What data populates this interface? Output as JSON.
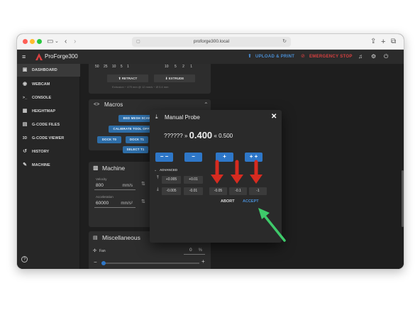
{
  "browser": {
    "url": "proforge300.local",
    "icons": [
      "sidebar-toggle-icon",
      "back-icon",
      "forward-icon",
      "lock-icon",
      "reload-icon",
      "share-icon",
      "new-tab-icon",
      "tabs-icon"
    ]
  },
  "appbar": {
    "title": "ProForge300",
    "upload_label": "UPLOAD & PRINT",
    "emergency_label": "EMERGENCY STOP",
    "colors": {
      "upload": "#4a8fd6",
      "emergency": "#d94040",
      "logo": "#d94040"
    }
  },
  "sidebar": {
    "items": [
      {
        "label": "DASHBOARD",
        "icon": "dashboard-icon",
        "glyph": "▣",
        "active": true
      },
      {
        "label": "WEBCAM",
        "icon": "webcam-icon",
        "glyph": "◉"
      },
      {
        "label": "CONSOLE",
        "icon": "console-icon",
        "glyph": ">_"
      },
      {
        "label": "HEIGHTMAP",
        "icon": "heightmap-icon",
        "glyph": "▦"
      },
      {
        "label": "G-CODE FILES",
        "icon": "files-icon",
        "glyph": "▤"
      },
      {
        "label": "G-CODE VIEWER",
        "icon": "viewer-3d-icon",
        "glyph": "3D"
      },
      {
        "label": "HISTORY",
        "icon": "history-icon",
        "glyph": "↺"
      },
      {
        "label": "MACHINE",
        "icon": "wrench-icon",
        "glyph": "✎"
      }
    ],
    "help_glyph": "?"
  },
  "extruder": {
    "amount_row_left": [
      "50",
      "25",
      "10",
      "5",
      "1"
    ],
    "amount_row_right": [
      "10",
      "5",
      "2",
      "1"
    ],
    "retract_label": "RETRACT",
    "extrude_label": "EXTRUDE",
    "estimate": "Extrusion ~ 479 mm @ 12 mm/s ~ Ø 0.4 mm"
  },
  "macros": {
    "title": "Macros",
    "buttons": [
      "BED MESH SCAN",
      "CALIBRATE TOOL OFFSETS",
      "DOCK T0",
      "DOCK T1",
      "SELECT T1"
    ]
  },
  "machine": {
    "title": "Machine",
    "velocity": {
      "label": "Velocity",
      "value": "800",
      "unit": "mm/s"
    },
    "acceleration": {
      "label": "Acceleration",
      "value": "60000",
      "unit": "mm/s²"
    },
    "behind_modal_value": "50",
    "behind_modal_unit": "%"
  },
  "misc": {
    "title": "Miscellaneous",
    "fan": {
      "label": "Fan",
      "value": "0",
      "unit": "%",
      "level": 0
    }
  },
  "probe": {
    "title": "Manual Probe",
    "unknown": "??????",
    "arrow_right": "»",
    "value": "0.400",
    "arrow_left": "«",
    "previous": "0.500",
    "quick_buttons": [
      "− −",
      "−",
      "+",
      "+ +"
    ],
    "advanced_label": "ADVANCED",
    "offsets_up": [
      "+0.005",
      "+0.01"
    ],
    "offsets_down": [
      "-0.005",
      "-0.01",
      "-0.05",
      "-0.1",
      "-1"
    ],
    "abort_label": "ABORT",
    "accept_label": "ACCEPT"
  }
}
